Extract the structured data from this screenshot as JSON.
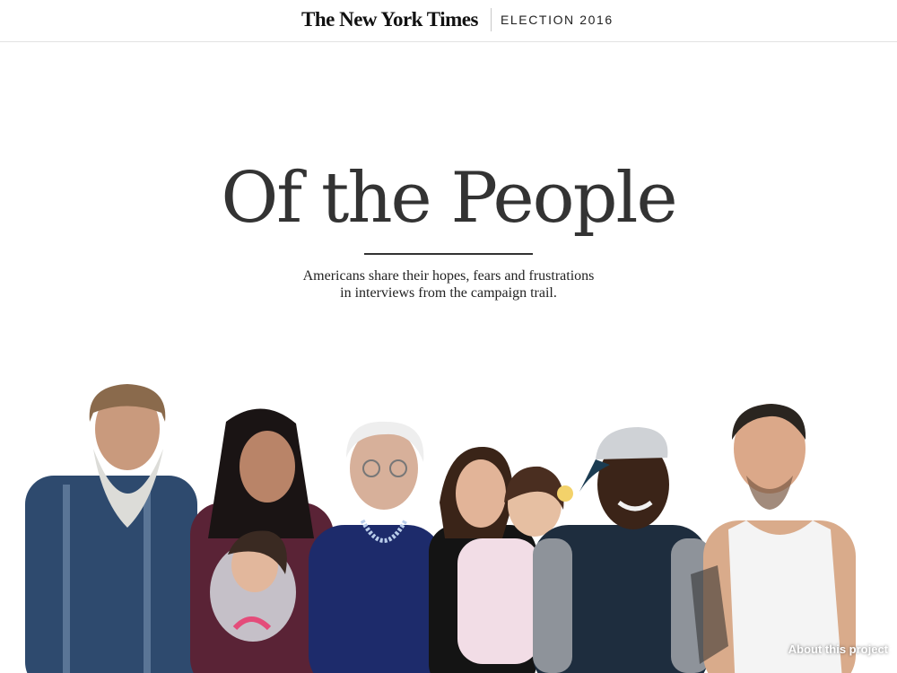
{
  "header": {
    "logo_text": "The New York Times",
    "section_label": "ELECTION 2016"
  },
  "hero": {
    "title": "Of the People",
    "subtitle_line1": "Americans share their hopes, fears and frustrations",
    "subtitle_line2": "in interviews from the campaign trail."
  },
  "photo": {
    "subjects": [
      "man-long-beard",
      "woman-holding-toddler",
      "elderly-woman-glasses",
      "woman-holding-girl",
      "young-man-cap",
      "man-tank-top"
    ]
  },
  "footer": {
    "about_label": "About this project"
  },
  "colors": {
    "background": "#ffffff",
    "text": "#333333",
    "divider": "#e2e2e2"
  }
}
